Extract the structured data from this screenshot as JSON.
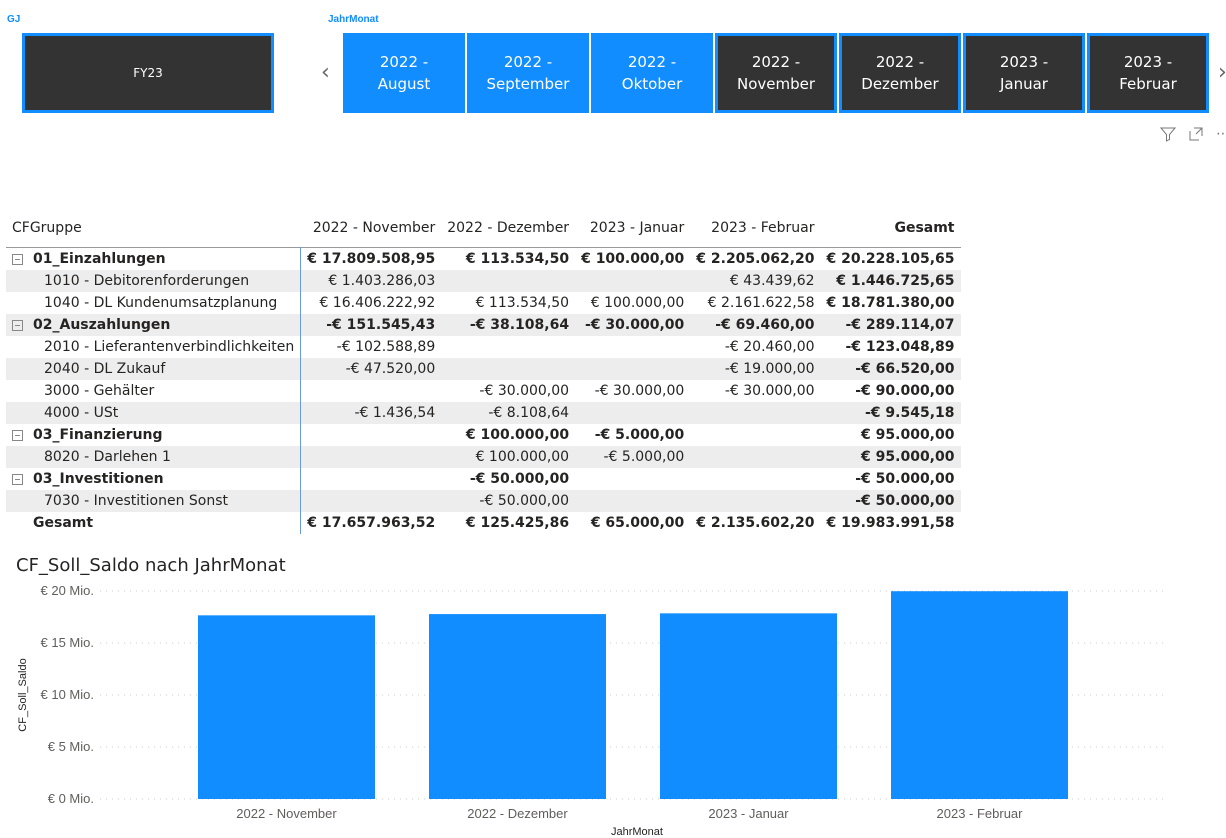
{
  "slicer_gj": {
    "title": "GJ",
    "value": "FY23"
  },
  "slicer_month": {
    "title": "JahrMonat",
    "tiles": [
      {
        "line1": "2022 -",
        "line2": "August",
        "selected": true
      },
      {
        "line1": "2022 -",
        "line2": "September",
        "selected": true
      },
      {
        "line1": "2022 -",
        "line2": "Oktober",
        "selected": true
      },
      {
        "line1": "2022 -",
        "line2": "November",
        "selected": false
      },
      {
        "line1": "2022 -",
        "line2": "Dezember",
        "selected": false
      },
      {
        "line1": "2023 -",
        "line2": "Januar",
        "selected": false
      },
      {
        "line1": "2023 -",
        "line2": "Februar",
        "selected": false
      }
    ]
  },
  "visual_header_icons": [
    "filter-icon",
    "focus-mode-icon",
    "more-options-icon"
  ],
  "matrix": {
    "headers": [
      "CFGruppe",
      "2022 - November",
      "2022 - Dezember",
      "2023 - Januar",
      "2023 - Februar",
      "Gesamt"
    ],
    "rows": [
      {
        "type": "group",
        "cells": [
          "01_Einzahlungen",
          "€ 17.809.508,95",
          "€ 113.534,50",
          "€ 100.000,00",
          "€ 2.205.062,20",
          "€ 20.228.105,65"
        ]
      },
      {
        "type": "item",
        "cells": [
          "1010 - Debitorenforderungen",
          "€ 1.403.286,03",
          "",
          "",
          "€ 43.439,62",
          "€ 1.446.725,65"
        ]
      },
      {
        "type": "item",
        "cells": [
          "1040 - DL Kundenumsatzplanung",
          "€ 16.406.222,92",
          "€ 113.534,50",
          "€ 100.000,00",
          "€ 2.161.622,58",
          "€ 18.781.380,00"
        ]
      },
      {
        "type": "group",
        "cells": [
          "02_Auszahlungen",
          "-€ 151.545,43",
          "-€ 38.108,64",
          "-€ 30.000,00",
          "-€ 69.460,00",
          "-€ 289.114,07"
        ]
      },
      {
        "type": "item",
        "cells": [
          "2010 - Lieferantenverbindlichkeiten",
          "-€ 102.588,89",
          "",
          "",
          "-€ 20.460,00",
          "-€ 123.048,89"
        ]
      },
      {
        "type": "item",
        "cells": [
          "2040 - DL Zukauf",
          "-€ 47.520,00",
          "",
          "",
          "-€ 19.000,00",
          "-€ 66.520,00"
        ]
      },
      {
        "type": "item",
        "cells": [
          "3000 - Gehälter",
          "",
          "-€ 30.000,00",
          "-€ 30.000,00",
          "-€ 30.000,00",
          "-€ 90.000,00"
        ]
      },
      {
        "type": "item",
        "cells": [
          "4000 - USt",
          "-€ 1.436,54",
          "-€ 8.108,64",
          "",
          "",
          "-€ 9.545,18"
        ]
      },
      {
        "type": "group",
        "cells": [
          "03_Finanzierung",
          "",
          "€ 100.000,00",
          "-€ 5.000,00",
          "",
          "€ 95.000,00"
        ]
      },
      {
        "type": "item",
        "cells": [
          "8020 - Darlehen 1",
          "",
          "€ 100.000,00",
          "-€ 5.000,00",
          "",
          "€ 95.000,00"
        ]
      },
      {
        "type": "group",
        "cells": [
          "03_Investitionen",
          "",
          "-€ 50.000,00",
          "",
          "",
          "-€ 50.000,00"
        ]
      },
      {
        "type": "item",
        "cells": [
          "7030 - Investitionen Sonst",
          "",
          "-€ 50.000,00",
          "",
          "",
          "-€ 50.000,00"
        ]
      },
      {
        "type": "total",
        "cells": [
          "Gesamt",
          "€ 17.657.963,52",
          "€ 125.425,86",
          "€ 65.000,00",
          "€ 2.135.602,20",
          "€ 19.983.991,58"
        ]
      }
    ]
  },
  "chart_data": {
    "type": "bar",
    "title": "CF_Soll_Saldo nach JahrMonat",
    "xlabel": "JahrMonat",
    "ylabel": "CF_Soll_Saldo",
    "categories": [
      "2022 - November",
      "2022 - Dezember",
      "2023 - Januar",
      "2023 - Februar"
    ],
    "values": [
      17.66,
      17.78,
      17.85,
      19.98
    ],
    "unit": "Mio. €",
    "ylim": [
      0,
      20
    ],
    "yticks": [
      0,
      5,
      10,
      15,
      20
    ],
    "ytick_labels": [
      "€ 0 Mio.",
      "€ 5 Mio.",
      "€ 10 Mio.",
      "€ 15 Mio.",
      "€ 20 Mio."
    ],
    "grid": true,
    "color": "#118dff"
  }
}
